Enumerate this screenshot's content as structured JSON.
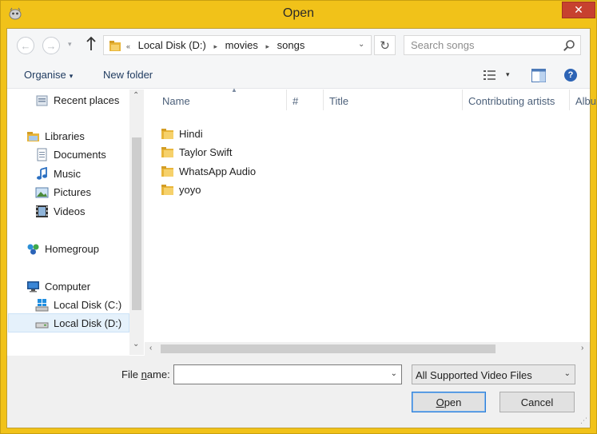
{
  "window": {
    "title": "Open",
    "close_glyph": "✕"
  },
  "nav": {
    "back_glyph": "←",
    "forward_glyph": "→",
    "recent_glyph": "▾",
    "path_prefix": "«",
    "breadcrumb": [
      "Local Disk (D:)",
      "movies",
      "songs"
    ],
    "breadcrumb_sep": "▸",
    "address_drop": "⌄",
    "refresh_glyph": "↻",
    "search_placeholder": "Search songs"
  },
  "toolbar": {
    "organise": "Organise",
    "organise_caret": "▾",
    "new_folder": "New folder",
    "views_caret": "▾",
    "help": "?"
  },
  "navpane": {
    "items": [
      {
        "label": "Recent places",
        "icon": "recent-places-icon"
      },
      {
        "label": "Libraries",
        "icon": "libraries-icon"
      },
      {
        "label": "Documents",
        "icon": "documents-icon"
      },
      {
        "label": "Music",
        "icon": "music-icon"
      },
      {
        "label": "Pictures",
        "icon": "pictures-icon"
      },
      {
        "label": "Videos",
        "icon": "videos-icon"
      },
      {
        "label": "Homegroup",
        "icon": "homegroup-icon"
      },
      {
        "label": "Computer",
        "icon": "computer-icon"
      },
      {
        "label": "Local Disk (C:)",
        "icon": "drive-c-icon"
      },
      {
        "label": "Local Disk (D:)",
        "icon": "drive-d-icon"
      }
    ],
    "selected": "Local Disk (D:)",
    "scroll_up": "⌃",
    "scroll_down": "⌄"
  },
  "columns": [
    "Name",
    "#",
    "Title",
    "Contributing artists",
    "Albu"
  ],
  "sort_glyph": "▲",
  "files": [
    "Hindi",
    "Taylor Swift",
    "WhatsApp Audio",
    "yoyo"
  ],
  "hscroll": {
    "left": "‹",
    "right": "›"
  },
  "bottom": {
    "file_name_label_pre": "File ",
    "file_name_label_u": "n",
    "file_name_label_post": "ame:",
    "file_name_value": "",
    "file_name_drop": "⌄",
    "file_type": "All Supported Video Files",
    "file_type_drop": "⌄",
    "open_pre": "",
    "open_u": "O",
    "open_post": "pen",
    "cancel": "Cancel",
    "grip": "⋰"
  },
  "colors": {
    "title_bar": "#f1c219",
    "close": "#c7412f",
    "selected": "#e5f1fb",
    "folder": "#e8b53a"
  }
}
